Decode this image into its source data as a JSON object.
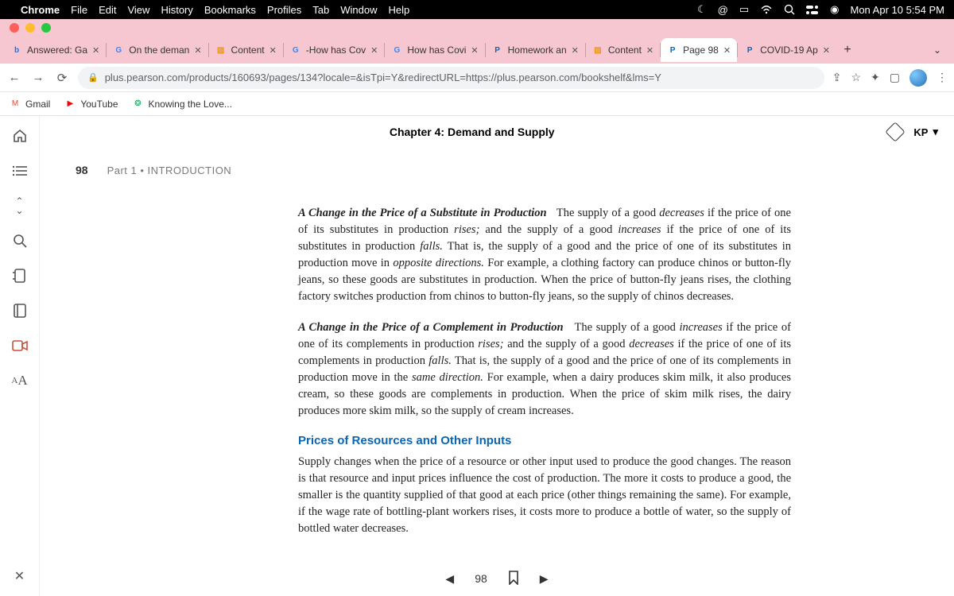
{
  "menubar": {
    "app": "Chrome",
    "items": [
      "File",
      "Edit",
      "View",
      "History",
      "Bookmarks",
      "Profiles",
      "Tab",
      "Window",
      "Help"
    ],
    "clock": "Mon Apr 10  5:54 PM"
  },
  "tabs": [
    {
      "favicon": "b",
      "color": "#1a73e8",
      "label": "Answered: Ga"
    },
    {
      "favicon": "G",
      "color": "#4285f4",
      "label": "On the deman"
    },
    {
      "favicon": "▨",
      "color": "#f29900",
      "label": "Content"
    },
    {
      "favicon": "G",
      "color": "#4285f4",
      "label": "-How has Cov"
    },
    {
      "favicon": "G",
      "color": "#4285f4",
      "label": "How has Covi"
    },
    {
      "favicon": "P",
      "color": "#0a66b5",
      "label": "Homework an"
    },
    {
      "favicon": "▨",
      "color": "#f29900",
      "label": "Content"
    },
    {
      "favicon": "P",
      "color": "#0a66b5",
      "label": "Page 98",
      "active": true
    },
    {
      "favicon": "P",
      "color": "#0a66b5",
      "label": "COVID-19 Ap"
    }
  ],
  "url": "plus.pearson.com/products/160693/pages/134?locale=&isTpi=Y&redirectURL=https://plus.pearson.com/bookshelf&lms=Y",
  "bookmarks": [
    {
      "icon": "M",
      "color": "#ea4335",
      "label": "Gmail"
    },
    {
      "icon": "▶",
      "color": "#ff0000",
      "label": "YouTube"
    },
    {
      "icon": "❂",
      "color": "#1a9e5c",
      "label": "Knowing the Love..."
    }
  ],
  "reader": {
    "chapter": "Chapter 4: Demand and Supply",
    "user": "KP",
    "page_number_runhead": "98",
    "part_label": "Part 1  •  INTRODUCTION",
    "para1_lead": "A Change in the Price of a Substitute in Production",
    "para1_html": "The supply of a good <em>decreases</em> if the price of one of its substitutes in production <em>rises;</em> and the supply of a good <em>increases</em> if the price of one of its substitutes in production <em>falls.</em> That is, the supply of a good and the price of one of its substitutes in production move in <em>opposite directions.</em> For example, a clothing factory can produce chinos or button-fly jeans, so these goods are substitutes in production. When the price of button-fly jeans rises, the clothing factory switches production from chinos to button-fly jeans, so the supply of chinos decreases.",
    "para2_lead": "A Change in the Price of a Complement in Production",
    "para2_html": "The supply of a good <em>increases</em> if the price of one of its complements in production <em>rises;</em> and the supply of a good <em>decreases</em> if the price of one of its complements in production <em>falls.</em> That is, the supply of a good and the price of one of its complements in production move in the <em>same direction.</em> For example, when a dairy produces skim milk, it also produces cream, so these goods are complements in production. When the price of skim milk rises, the dairy produces more skim milk, so the supply of cream increases.",
    "heading3": "Prices of Resources and Other Inputs",
    "para3": "Supply changes when the price of a resource or other input used to produce the good changes. The reason is that resource and input prices influence the cost of production. The more it costs to produce a good, the smaller is the quantity supplied of that good at each price (other things remaining the same). For example, if the wage rate of bottling-plant workers rises, it costs more to produce a bottle of water, so the supply of bottled water decreases.",
    "pager_page": "98"
  }
}
